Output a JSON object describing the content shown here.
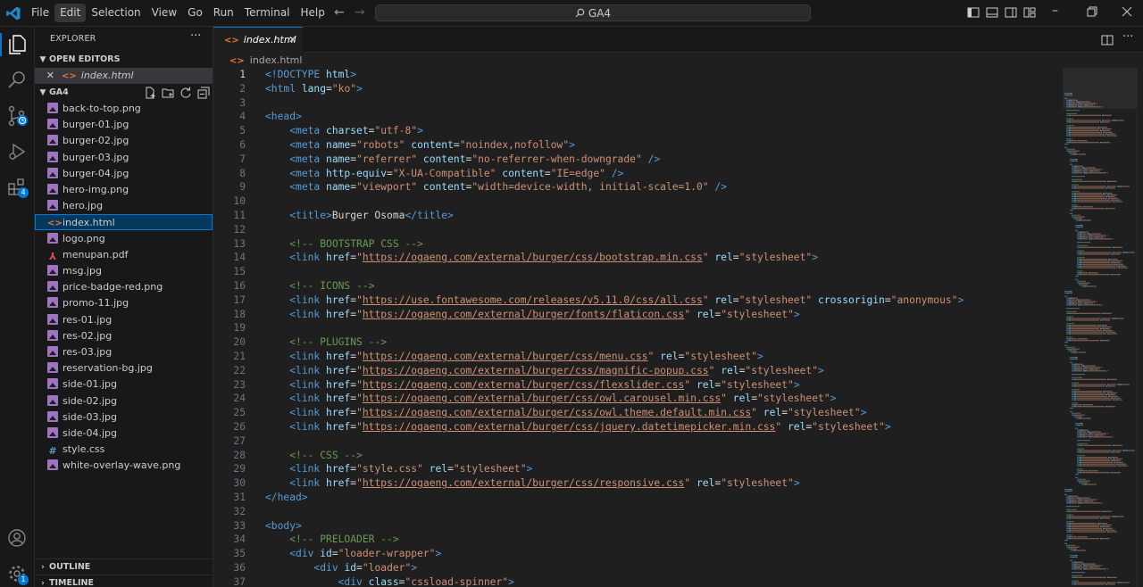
{
  "titlebar": {
    "menu": [
      "File",
      "Edit",
      "Selection",
      "View",
      "Go",
      "Run",
      "Terminal",
      "Help"
    ],
    "active_menu": "Edit",
    "search_text": "GA4"
  },
  "activity": {
    "source_control_badge": "",
    "extensions_badge": "4",
    "settings_badge": "1"
  },
  "sidebar": {
    "title": "EXPLORER",
    "more": "···",
    "open_editors_label": "OPEN EDITORS",
    "open_editor_file": "index.html",
    "workspace_label": "GA4",
    "files": [
      {
        "name": "back-to-top.png",
        "type": "img"
      },
      {
        "name": "burger-01.jpg",
        "type": "img"
      },
      {
        "name": "burger-02.jpg",
        "type": "img"
      },
      {
        "name": "burger-03.jpg",
        "type": "img"
      },
      {
        "name": "burger-04.jpg",
        "type": "img"
      },
      {
        "name": "hero-img.png",
        "type": "img"
      },
      {
        "name": "hero.jpg",
        "type": "img"
      },
      {
        "name": "index.html",
        "type": "html"
      },
      {
        "name": "logo.png",
        "type": "img"
      },
      {
        "name": "menupan.pdf",
        "type": "pdf"
      },
      {
        "name": "msg.jpg",
        "type": "img"
      },
      {
        "name": "price-badge-red.png",
        "type": "img"
      },
      {
        "name": "promo-11.jpg",
        "type": "img"
      },
      {
        "name": "res-01.jpg",
        "type": "img"
      },
      {
        "name": "res-02.jpg",
        "type": "img"
      },
      {
        "name": "res-03.jpg",
        "type": "img"
      },
      {
        "name": "reservation-bg.jpg",
        "type": "img"
      },
      {
        "name": "side-01.jpg",
        "type": "img"
      },
      {
        "name": "side-02.jpg",
        "type": "img"
      },
      {
        "name": "side-03.jpg",
        "type": "img"
      },
      {
        "name": "side-04.jpg",
        "type": "img"
      },
      {
        "name": "style.css",
        "type": "css"
      },
      {
        "name": "white-overlay-wave.png",
        "type": "img"
      }
    ],
    "selected_file": "index.html",
    "outline_label": "OUTLINE",
    "timeline_label": "TIMELINE"
  },
  "editor": {
    "tab_label": "index.html",
    "breadcrumb": "index.html",
    "current_line": 1,
    "lines": [
      [
        [
          "t",
          "<!DOCTYPE "
        ],
        [
          "a",
          "html"
        ],
        [
          "t",
          ">"
        ]
      ],
      [
        [
          "t",
          "<html "
        ],
        [
          "a",
          "lang"
        ],
        [
          "x",
          "="
        ],
        [
          "s",
          "\"ko\""
        ],
        [
          "t",
          ">"
        ]
      ],
      [],
      [
        [
          "t",
          "<head>"
        ]
      ],
      [
        [
          "x",
          "    "
        ],
        [
          "t",
          "<meta "
        ],
        [
          "a",
          "charset"
        ],
        [
          "x",
          "="
        ],
        [
          "s",
          "\"utf-8\""
        ],
        [
          "t",
          ">"
        ]
      ],
      [
        [
          "x",
          "    "
        ],
        [
          "t",
          "<meta "
        ],
        [
          "a",
          "name"
        ],
        [
          "x",
          "="
        ],
        [
          "s",
          "\"robots\""
        ],
        [
          "x",
          " "
        ],
        [
          "a",
          "content"
        ],
        [
          "x",
          "="
        ],
        [
          "s",
          "\"noindex,nofollow\""
        ],
        [
          "t",
          ">"
        ]
      ],
      [
        [
          "x",
          "    "
        ],
        [
          "t",
          "<meta "
        ],
        [
          "a",
          "name"
        ],
        [
          "x",
          "="
        ],
        [
          "s",
          "\"referrer\""
        ],
        [
          "x",
          " "
        ],
        [
          "a",
          "content"
        ],
        [
          "x",
          "="
        ],
        [
          "s",
          "\"no-referrer-when-downgrade\""
        ],
        [
          "x",
          " "
        ],
        [
          "t",
          "/>"
        ]
      ],
      [
        [
          "x",
          "    "
        ],
        [
          "t",
          "<meta "
        ],
        [
          "a",
          "http-equiv"
        ],
        [
          "x",
          "="
        ],
        [
          "s",
          "\"X-UA-Compatible\""
        ],
        [
          "x",
          " "
        ],
        [
          "a",
          "content"
        ],
        [
          "x",
          "="
        ],
        [
          "s",
          "\"IE=edge\""
        ],
        [
          "x",
          " "
        ],
        [
          "t",
          "/>"
        ]
      ],
      [
        [
          "x",
          "    "
        ],
        [
          "t",
          "<meta "
        ],
        [
          "a",
          "name"
        ],
        [
          "x",
          "="
        ],
        [
          "s",
          "\"viewport\""
        ],
        [
          "x",
          " "
        ],
        [
          "a",
          "content"
        ],
        [
          "x",
          "="
        ],
        [
          "s",
          "\"width=device-width, initial-scale=1.0\""
        ],
        [
          "x",
          " "
        ],
        [
          "t",
          "/>"
        ]
      ],
      [],
      [
        [
          "x",
          "    "
        ],
        [
          "t",
          "<title>"
        ],
        [
          "x",
          "Burger Osoma"
        ],
        [
          "t",
          "</title>"
        ]
      ],
      [],
      [
        [
          "x",
          "    "
        ],
        [
          "c",
          "<!-- BOOTSTRAP CSS -->"
        ]
      ],
      [
        [
          "x",
          "    "
        ],
        [
          "t",
          "<link "
        ],
        [
          "a",
          "href"
        ],
        [
          "x",
          "="
        ],
        [
          "s",
          "\""
        ],
        [
          "su",
          "https://ogaeng.com/external/burger/css/bootstrap.min.css"
        ],
        [
          "s",
          "\""
        ],
        [
          "x",
          " "
        ],
        [
          "a",
          "rel"
        ],
        [
          "x",
          "="
        ],
        [
          "s",
          "\"stylesheet\""
        ],
        [
          "t",
          ">"
        ]
      ],
      [],
      [
        [
          "x",
          "    "
        ],
        [
          "c",
          "<!-- ICONS -->"
        ]
      ],
      [
        [
          "x",
          "    "
        ],
        [
          "t",
          "<link "
        ],
        [
          "a",
          "href"
        ],
        [
          "x",
          "="
        ],
        [
          "s",
          "\""
        ],
        [
          "su",
          "https://use.fontawesome.com/releases/v5.11.0/css/all.css"
        ],
        [
          "s",
          "\""
        ],
        [
          "x",
          " "
        ],
        [
          "a",
          "rel"
        ],
        [
          "x",
          "="
        ],
        [
          "s",
          "\"stylesheet\""
        ],
        [
          "x",
          " "
        ],
        [
          "a",
          "crossorigin"
        ],
        [
          "x",
          "="
        ],
        [
          "s",
          "\"anonymous\""
        ],
        [
          "t",
          ">"
        ]
      ],
      [
        [
          "x",
          "    "
        ],
        [
          "t",
          "<link "
        ],
        [
          "a",
          "href"
        ],
        [
          "x",
          "="
        ],
        [
          "s",
          "\""
        ],
        [
          "su",
          "https://ogaeng.com/external/burger/fonts/flaticon.css"
        ],
        [
          "s",
          "\""
        ],
        [
          "x",
          " "
        ],
        [
          "a",
          "rel"
        ],
        [
          "x",
          "="
        ],
        [
          "s",
          "\"stylesheet\""
        ],
        [
          "t",
          ">"
        ]
      ],
      [],
      [
        [
          "x",
          "    "
        ],
        [
          "c",
          "<!-- PLUGINS -->"
        ]
      ],
      [
        [
          "x",
          "    "
        ],
        [
          "t",
          "<link "
        ],
        [
          "a",
          "href"
        ],
        [
          "x",
          "="
        ],
        [
          "s",
          "\""
        ],
        [
          "su",
          "https://ogaeng.com/external/burger/css/menu.css"
        ],
        [
          "s",
          "\""
        ],
        [
          "x",
          " "
        ],
        [
          "a",
          "rel"
        ],
        [
          "x",
          "="
        ],
        [
          "s",
          "\"stylesheet\""
        ],
        [
          "t",
          ">"
        ]
      ],
      [
        [
          "x",
          "    "
        ],
        [
          "t",
          "<link "
        ],
        [
          "a",
          "href"
        ],
        [
          "x",
          "="
        ],
        [
          "s",
          "\""
        ],
        [
          "su",
          "https://ogaeng.com/external/burger/css/magnific-popup.css"
        ],
        [
          "s",
          "\""
        ],
        [
          "x",
          " "
        ],
        [
          "a",
          "rel"
        ],
        [
          "x",
          "="
        ],
        [
          "s",
          "\"stylesheet\""
        ],
        [
          "t",
          ">"
        ]
      ],
      [
        [
          "x",
          "    "
        ],
        [
          "t",
          "<link "
        ],
        [
          "a",
          "href"
        ],
        [
          "x",
          "="
        ],
        [
          "s",
          "\""
        ],
        [
          "su",
          "https://ogaeng.com/external/burger/css/flexslider.css"
        ],
        [
          "s",
          "\""
        ],
        [
          "x",
          " "
        ],
        [
          "a",
          "rel"
        ],
        [
          "x",
          "="
        ],
        [
          "s",
          "\"stylesheet\""
        ],
        [
          "t",
          ">"
        ]
      ],
      [
        [
          "x",
          "    "
        ],
        [
          "t",
          "<link "
        ],
        [
          "a",
          "href"
        ],
        [
          "x",
          "="
        ],
        [
          "s",
          "\""
        ],
        [
          "su",
          "https://ogaeng.com/external/burger/css/owl.carousel.min.css"
        ],
        [
          "s",
          "\""
        ],
        [
          "x",
          " "
        ],
        [
          "a",
          "rel"
        ],
        [
          "x",
          "="
        ],
        [
          "s",
          "\"stylesheet\""
        ],
        [
          "t",
          ">"
        ]
      ],
      [
        [
          "x",
          "    "
        ],
        [
          "t",
          "<link "
        ],
        [
          "a",
          "href"
        ],
        [
          "x",
          "="
        ],
        [
          "s",
          "\""
        ],
        [
          "su",
          "https://ogaeng.com/external/burger/css/owl.theme.default.min.css"
        ],
        [
          "s",
          "\""
        ],
        [
          "x",
          " "
        ],
        [
          "a",
          "rel"
        ],
        [
          "x",
          "="
        ],
        [
          "s",
          "\"stylesheet\""
        ],
        [
          "t",
          ">"
        ]
      ],
      [
        [
          "x",
          "    "
        ],
        [
          "t",
          "<link "
        ],
        [
          "a",
          "href"
        ],
        [
          "x",
          "="
        ],
        [
          "s",
          "\""
        ],
        [
          "su",
          "https://ogaeng.com/external/burger/css/jquery.datetimepicker.min.css"
        ],
        [
          "s",
          "\""
        ],
        [
          "x",
          " "
        ],
        [
          "a",
          "rel"
        ],
        [
          "x",
          "="
        ],
        [
          "s",
          "\"stylesheet\""
        ],
        [
          "t",
          ">"
        ]
      ],
      [],
      [
        [
          "x",
          "    "
        ],
        [
          "c",
          "<!-- CSS -->"
        ]
      ],
      [
        [
          "x",
          "    "
        ],
        [
          "t",
          "<link "
        ],
        [
          "a",
          "href"
        ],
        [
          "x",
          "="
        ],
        [
          "s",
          "\"style.css\""
        ],
        [
          "x",
          " "
        ],
        [
          "a",
          "rel"
        ],
        [
          "x",
          "="
        ],
        [
          "s",
          "\"stylesheet\""
        ],
        [
          "t",
          ">"
        ]
      ],
      [
        [
          "x",
          "    "
        ],
        [
          "t",
          "<link "
        ],
        [
          "a",
          "href"
        ],
        [
          "x",
          "="
        ],
        [
          "s",
          "\""
        ],
        [
          "su",
          "https://ogaeng.com/external/burger/css/responsive.css"
        ],
        [
          "s",
          "\""
        ],
        [
          "x",
          " "
        ],
        [
          "a",
          "rel"
        ],
        [
          "x",
          "="
        ],
        [
          "s",
          "\"stylesheet\""
        ],
        [
          "t",
          ">"
        ]
      ],
      [
        [
          "t",
          "</head>"
        ]
      ],
      [],
      [
        [
          "t",
          "<body>"
        ]
      ],
      [
        [
          "x",
          "    "
        ],
        [
          "c",
          "<!-- PRELOADER -->"
        ]
      ],
      [
        [
          "x",
          "    "
        ],
        [
          "t",
          "<div "
        ],
        [
          "a",
          "id"
        ],
        [
          "x",
          "="
        ],
        [
          "s",
          "\"loader-wrapper\""
        ],
        [
          "t",
          ">"
        ]
      ],
      [
        [
          "x",
          "        "
        ],
        [
          "t",
          "<div "
        ],
        [
          "a",
          "id"
        ],
        [
          "x",
          "="
        ],
        [
          "s",
          "\"loader\""
        ],
        [
          "t",
          ">"
        ]
      ],
      [
        [
          "x",
          "            "
        ],
        [
          "t",
          "<div "
        ],
        [
          "a",
          "class"
        ],
        [
          "x",
          "="
        ],
        [
          "s",
          "\"cssload-spinner\""
        ],
        [
          "t",
          ">"
        ]
      ]
    ]
  },
  "colors": {
    "accent": "#0078d4",
    "tag": "#569cd6",
    "attr": "#9cdcfe",
    "string": "#ce9178",
    "comment": "#6a9955"
  }
}
